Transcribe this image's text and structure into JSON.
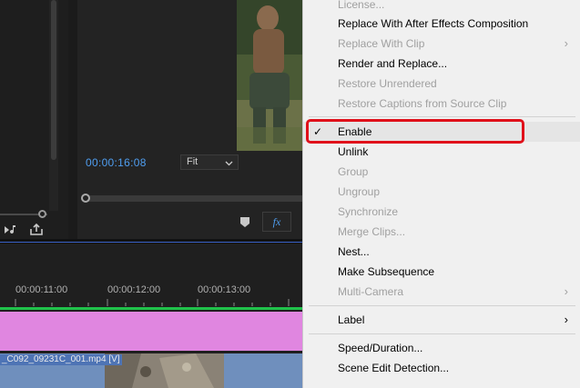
{
  "program_monitor": {
    "timecode": "00:00:16:08",
    "zoom_value": "Fit",
    "fx_label": "fx"
  },
  "timeline": {
    "ruler_labels": [
      "00:00:11:00",
      "00:00:12:00",
      "00:00:13:00"
    ],
    "clip_name": "_C092_09231C_001.mp4 [V]"
  },
  "context_menu": {
    "items": [
      {
        "label": "License...",
        "enabled": false
      },
      {
        "label": "Replace With After Effects Composition",
        "enabled": true
      },
      {
        "label": "Replace With Clip",
        "enabled": false,
        "submenu": true
      },
      {
        "label": "Render and Replace...",
        "enabled": true
      },
      {
        "label": "Restore Unrendered",
        "enabled": false
      },
      {
        "label": "Restore Captions from Source Clip",
        "enabled": false
      },
      {
        "label": "Enable",
        "enabled": true,
        "checked": true,
        "highlighted": true
      },
      {
        "label": "Unlink",
        "enabled": true
      },
      {
        "label": "Group",
        "enabled": false
      },
      {
        "label": "Ungroup",
        "enabled": false
      },
      {
        "label": "Synchronize",
        "enabled": false
      },
      {
        "label": "Merge Clips...",
        "enabled": false
      },
      {
        "label": "Nest...",
        "enabled": true
      },
      {
        "label": "Make Subsequence",
        "enabled": true
      },
      {
        "label": "Multi-Camera",
        "enabled": false,
        "submenu": true
      },
      {
        "label": "Label",
        "enabled": true,
        "submenu": true
      },
      {
        "label": "Speed/Duration...",
        "enabled": true
      },
      {
        "label": "Scene Edit Detection...",
        "enabled": true
      }
    ],
    "check_glyph": "✓",
    "arrow_glyph": "›",
    "highlight_color": "#e0101a"
  },
  "colors": {
    "accent_blue": "#4f9ef0",
    "timeline_green": "#1fc24a",
    "track_pink": "#e086e0"
  }
}
